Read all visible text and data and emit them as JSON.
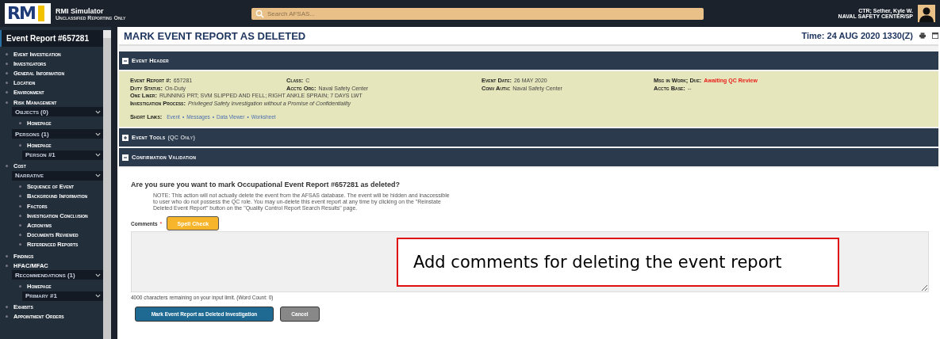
{
  "header": {
    "logo_text": "RM",
    "app_title": "RMI Simulator",
    "subtitle": "Unclassified Reporting Only",
    "search": {
      "placeholder": "Search AFSAS..."
    },
    "user": {
      "name": "CTR; Sether, Kyle W.",
      "org": "NAVAL SAFETY CENTER/SP"
    }
  },
  "sidebar": {
    "title": "Event Report #657281",
    "items": [
      {
        "kind": "link",
        "label": "Event Investigation"
      },
      {
        "kind": "link",
        "label": "Investigators"
      },
      {
        "kind": "link",
        "label": "General Information"
      },
      {
        "kind": "link",
        "label": "Location"
      },
      {
        "kind": "link",
        "label": "Environment"
      },
      {
        "kind": "link",
        "label": "Risk Management"
      },
      {
        "kind": "group",
        "label": "Objects (0)",
        "children": [
          {
            "kind": "link",
            "label": "Homepage"
          }
        ]
      },
      {
        "kind": "group",
        "label": "Persons (1)",
        "children": [
          {
            "kind": "link",
            "label": "Homepage"
          },
          {
            "kind": "select",
            "label": "Person #1"
          }
        ]
      },
      {
        "kind": "link",
        "label": "Cost"
      },
      {
        "kind": "group",
        "label": "Narrative",
        "children": [
          {
            "kind": "link",
            "label": "Sequence of Event"
          },
          {
            "kind": "link",
            "label": "Background Information"
          },
          {
            "kind": "link",
            "label": "Factors"
          },
          {
            "kind": "link",
            "label": "Investigation Conclusion"
          },
          {
            "kind": "link",
            "label": "Acronyms"
          },
          {
            "kind": "link",
            "label": "Documents Reviewed"
          },
          {
            "kind": "link",
            "label": "Referenced Reports"
          }
        ]
      },
      {
        "kind": "link",
        "label": "Findings"
      },
      {
        "kind": "link",
        "label": "HFAC/MFAC"
      },
      {
        "kind": "group",
        "label": "Recommendations (1)",
        "children": [
          {
            "kind": "link",
            "label": "Homepage"
          },
          {
            "kind": "select",
            "label": "Primary #1"
          }
        ]
      },
      {
        "kind": "link",
        "label": "Exhibits"
      },
      {
        "kind": "link",
        "label": "Appointment Orders"
      }
    ]
  },
  "page": {
    "title": "MARK EVENT REPORT AS DELETED",
    "time": "Time: 24 AUG 2020 1330(Z)"
  },
  "sections": [
    {
      "title": "Event Header",
      "expanded": true
    },
    {
      "title": "Event Tools",
      "note": "(QC Only)",
      "expanded": false
    },
    {
      "title": "Confirmation Validation",
      "expanded": true
    }
  ],
  "event_header": {
    "fields": [
      {
        "label": "Event Report #:",
        "value": "657281",
        "kind": "plain"
      },
      {
        "label": "Class:",
        "value": "C",
        "kind": "plain"
      },
      {
        "label": "Event Date:",
        "value": "26 MAY 2020",
        "kind": "plain"
      },
      {
        "label": "Msg in Work; Due:",
        "value": "Awaiting QC Review",
        "kind": "alert"
      },
      {
        "label": "Duty Status:",
        "value": "On-Duty",
        "kind": "plain"
      },
      {
        "label": "Acctg Org:",
        "value": "Naval Safety Center",
        "kind": "plain"
      },
      {
        "label": "Conv Auth:",
        "value": "Naval Safety Center",
        "kind": "plain"
      },
      {
        "label": "Acctg Base:",
        "value": "--",
        "kind": "plain"
      }
    ],
    "lines": [
      {
        "label": "One Liner:",
        "value": "RUNNING PRT; SVM SLIPPED AND FELL; RIGHT ANKLE SPRAIN; 7 DAYS LWT",
        "kind": "plain"
      },
      {
        "label": "Investigation Process:",
        "value": "Privileged Safety Investigation without a Promise of Confidentiality",
        "kind": "italic"
      }
    ],
    "short_links": {
      "label": "Short Links:",
      "separator": "•",
      "links": [
        "Event",
        "Messages",
        "Data Viewer",
        "Worksheet"
      ]
    }
  },
  "confirmation": {
    "question": "Are you sure you want to mark Occupational Event Report #657281 as deleted?",
    "note": "NOTE: This action will not actually delete the event from the AFSAS database. The event will be hidden and inaccessible to user who do not possess the QC role. You may un-delete this event report at any time by clicking on the \"Reinstate Deleted Event Report\" button on the \"Quality Control Report Search Results\" page.",
    "comments_label": "Comments",
    "required_mark": "*",
    "spell_check": "Spell Check",
    "counter": "4000 characters remaining on your input limit. (Word Count: 0)",
    "buttons": [
      {
        "label": "Mark Event Report as Deleted Investigation",
        "kind": "primary"
      },
      {
        "label": "Cancel",
        "kind": "secondary"
      }
    ]
  },
  "callout": {
    "text": "Add comments for deleting the event report"
  }
}
